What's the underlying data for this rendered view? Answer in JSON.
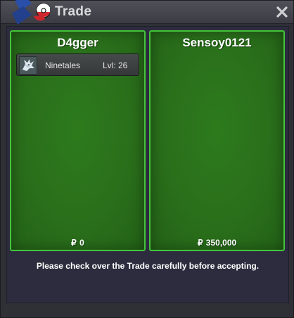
{
  "window": {
    "title": "Trade",
    "close_icon": "close-icon",
    "logo_icon": "pokeball-logo-icon"
  },
  "left_panel": {
    "player": "D4gger",
    "currency_symbol": "₽",
    "money": "0",
    "items": [
      {
        "icon": "ninetales-sprite-icon",
        "name": "Ninetales",
        "level": "Lvl: 26"
      }
    ]
  },
  "right_panel": {
    "player": "Sensoy0121",
    "currency_symbol": "₽",
    "money": "350,000",
    "items": []
  },
  "notice": "Please check over the Trade carefully before accepting.",
  "colors": {
    "panel_border": "#43c43a",
    "panel_fill": "#2a6f1b",
    "window_bg": "#2d2c3e"
  }
}
